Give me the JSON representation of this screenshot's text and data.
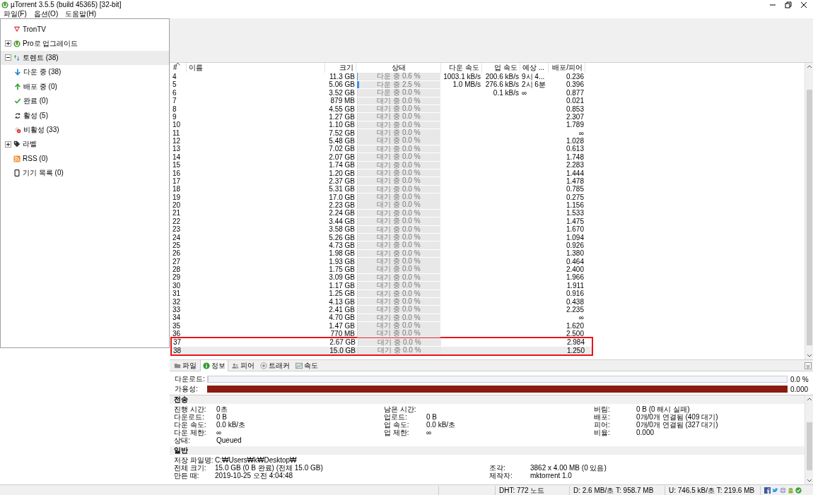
{
  "window": {
    "title": "µTorrent 3.5.5  (build 45365) [32-bit]"
  },
  "menu": [
    "파일(F)",
    "옵션(O)",
    "도움말(H)"
  ],
  "sidebar": {
    "items": [
      {
        "label": "TronTV",
        "kind": "tron",
        "selected": false
      },
      {
        "label": "Pro로 업그레이드",
        "kind": "utorrent",
        "selected": false,
        "expanded": false
      },
      {
        "label": "토렌트 (38)",
        "kind": "torrents",
        "selected": true,
        "expanded": true,
        "children": [
          {
            "label": "다운 중 (38)",
            "kind": "down",
            "selected": false
          },
          {
            "label": "배포 중 (0)",
            "kind": "up",
            "selected": false
          },
          {
            "label": "완료 (0)",
            "kind": "check",
            "selected": false
          },
          {
            "label": "활성 (5)",
            "kind": "refresh",
            "selected": false
          },
          {
            "label": "비활성 (33)",
            "kind": "inactive",
            "selected": false
          }
        ]
      },
      {
        "label": "라벨",
        "kind": "tag",
        "selected": false,
        "expanded": false
      },
      {
        "label": "RSS (0)",
        "kind": "rss",
        "selected": false
      },
      {
        "label": "기기 목록 (0)",
        "kind": "device",
        "selected": false
      }
    ]
  },
  "table": {
    "columns": [
      "#",
      "이름",
      "크기",
      "상태",
      "다운 속도",
      "업 속도",
      "예상 ...",
      "배포/피어"
    ],
    "rows": [
      {
        "num": "4",
        "size": "11.3 GB",
        "status": "다운 중 0.6 %",
        "level": 0.006,
        "down": "1003.1 kB/s",
        "up": "200.6 kB/s",
        "eta": "9시 4...",
        "ratio": "0.236",
        "selected": false,
        "outlined": false
      },
      {
        "num": "5",
        "size": "5.06 GB",
        "status": "다운 중 2.5 %",
        "level": 0.025,
        "down": "1.0 MB/s",
        "up": "276.6 kB/s",
        "eta": "2시 6분",
        "ratio": "0.396",
        "selected": false,
        "outlined": false
      },
      {
        "num": "6",
        "size": "3.52 GB",
        "status": "다운 중 0.0 %",
        "level": 0,
        "up": "0.1 kB/s",
        "eta": "∞",
        "ratio": "0.877",
        "selected": false,
        "outlined": false
      },
      {
        "num": "7",
        "size": "879 MB",
        "status": "대기 중 0.0 %",
        "level": 0,
        "ratio": "0.021",
        "selected": false,
        "outlined": false
      },
      {
        "num": "8",
        "size": "4.55 GB",
        "status": "대기 중 0.0 %",
        "level": 0,
        "ratio": "0.853",
        "selected": false,
        "outlined": false
      },
      {
        "num": "9",
        "size": "1.27 GB",
        "status": "대기 중 0.0 %",
        "level": 0,
        "ratio": "2.307",
        "selected": false,
        "outlined": false
      },
      {
        "num": "10",
        "size": "1.10 GB",
        "status": "대기 중 0.0 %",
        "level": 0,
        "ratio": "1.789",
        "selected": false,
        "outlined": false
      },
      {
        "num": "11",
        "size": "7.52 GB",
        "status": "대기 중 0.0 %",
        "level": 0,
        "ratio": "∞",
        "selected": false,
        "outlined": false
      },
      {
        "num": "12",
        "size": "5.48 GB",
        "status": "대기 중 0.0 %",
        "level": 0,
        "ratio": "1.028",
        "selected": false,
        "outlined": false
      },
      {
        "num": "13",
        "size": "7.02 GB",
        "status": "대기 중 0.0 %",
        "level": 0,
        "ratio": "0.613",
        "selected": false,
        "outlined": false
      },
      {
        "num": "14",
        "size": "2.07 GB",
        "status": "대기 중 0.0 %",
        "level": 0,
        "ratio": "1.748",
        "selected": false,
        "outlined": false
      },
      {
        "num": "15",
        "size": "1.74 GB",
        "status": "대기 중 0.0 %",
        "level": 0,
        "ratio": "2.283",
        "selected": false,
        "outlined": false
      },
      {
        "num": "16",
        "size": "1.20 GB",
        "status": "대기 중 0.0 %",
        "level": 0,
        "ratio": "1.444",
        "selected": false,
        "outlined": false
      },
      {
        "num": "17",
        "size": "2.37 GB",
        "status": "대기 중 0.0 %",
        "level": 0,
        "ratio": "1.478",
        "selected": false,
        "outlined": false
      },
      {
        "num": "18",
        "size": "5.31 GB",
        "status": "대기 중 0.0 %",
        "level": 0,
        "ratio": "0.785",
        "selected": false,
        "outlined": false
      },
      {
        "num": "19",
        "size": "17.0 GB",
        "status": "대기 중 0.0 %",
        "level": 0,
        "ratio": "0.275",
        "selected": false,
        "outlined": false
      },
      {
        "num": "20",
        "size": "2.23 GB",
        "status": "대기 중 0.0 %",
        "level": 0,
        "ratio": "1.156",
        "selected": false,
        "outlined": false
      },
      {
        "num": "21",
        "size": "2.24 GB",
        "status": "대기 중 0.0 %",
        "level": 0,
        "ratio": "1.533",
        "selected": false,
        "outlined": false
      },
      {
        "num": "22",
        "size": "3.44 GB",
        "status": "대기 중 0.0 %",
        "level": 0,
        "ratio": "1.475",
        "selected": false,
        "outlined": false
      },
      {
        "num": "23",
        "size": "3.58 GB",
        "status": "대기 중 0.0 %",
        "level": 0,
        "ratio": "1.670",
        "selected": false,
        "outlined": false
      },
      {
        "num": "24",
        "size": "5.26 GB",
        "status": "대기 중 0.0 %",
        "level": 0,
        "ratio": "1.094",
        "selected": false,
        "outlined": false
      },
      {
        "num": "25",
        "size": "4.73 GB",
        "status": "대기 중 0.0 %",
        "level": 0,
        "ratio": "0.926",
        "selected": false,
        "outlined": false
      },
      {
        "num": "26",
        "size": "1.98 GB",
        "status": "대기 중 0.0 %",
        "level": 0,
        "ratio": "1.380",
        "selected": false,
        "outlined": false
      },
      {
        "num": "27",
        "size": "1.93 GB",
        "status": "대기 중 0.0 %",
        "level": 0,
        "ratio": "0.464",
        "selected": false,
        "outlined": false
      },
      {
        "num": "28",
        "size": "1.75 GB",
        "status": "대기 중 0.0 %",
        "level": 0,
        "ratio": "2.400",
        "selected": false,
        "outlined": false
      },
      {
        "num": "29",
        "size": "3.09 GB",
        "status": "대기 중 0.0 %",
        "level": 0,
        "ratio": "1.966",
        "selected": false,
        "outlined": false
      },
      {
        "num": "30",
        "size": "1.17 GB",
        "status": "대기 중 0.0 %",
        "level": 0,
        "ratio": "1.911",
        "selected": false,
        "outlined": false
      },
      {
        "num": "31",
        "size": "1.25 GB",
        "status": "대기 중 0.0 %",
        "level": 0,
        "ratio": "0.916",
        "selected": false,
        "outlined": false
      },
      {
        "num": "32",
        "size": "4.13 GB",
        "status": "대기 중 0.0 %",
        "level": 0,
        "ratio": "0.438",
        "selected": false,
        "outlined": false
      },
      {
        "num": "33",
        "size": "2.41 GB",
        "status": "대기 중 0.0 %",
        "level": 0,
        "ratio": "2.235",
        "selected": false,
        "outlined": false
      },
      {
        "num": "34",
        "size": "4.70 GB",
        "status": "대기 중 0.0 %",
        "level": 0,
        "ratio": "∞",
        "selected": false,
        "outlined": false
      },
      {
        "num": "35",
        "size": "1.47 GB",
        "status": "대기 중 0.0 %",
        "level": 0,
        "ratio": "1.620",
        "selected": false,
        "outlined": false
      },
      {
        "num": "36",
        "size": "770 MB",
        "status": "대기 중 0.0 %",
        "level": 0,
        "ratio": "2.500",
        "selected": false,
        "outlined": false
      },
      {
        "num": "37",
        "size": "2.67 GB",
        "status": "대기 중 0.0 %",
        "level": 0,
        "ratio": "2.984",
        "selected": false,
        "outlined": true
      },
      {
        "num": "38",
        "size": "15.0 GB",
        "status": "대기 중 0.0 %",
        "level": 0,
        "ratio": "1.250",
        "selected": true,
        "outlined": true
      }
    ]
  },
  "detail_tabs": [
    {
      "label": "파일",
      "kind": "folder",
      "selected": false
    },
    {
      "label": "정보",
      "kind": "info",
      "selected": true
    },
    {
      "label": "피어",
      "kind": "peers",
      "selected": false
    },
    {
      "label": "트래커",
      "kind": "tracker",
      "selected": false
    },
    {
      "label": "속도",
      "kind": "graph",
      "selected": false
    }
  ],
  "bars": [
    {
      "label": "다운로드:",
      "level": 0,
      "reading": "0.0 %",
      "kind": "progress"
    },
    {
      "label": "가용성:",
      "level": 1,
      "reading": "0.000",
      "kind": "availability"
    }
  ],
  "sections": [
    {
      "title": "전송",
      "columns": [
        [
          {
            "label": "진행 시간:",
            "value": "0초"
          },
          {
            "label": "다운로드:",
            "value": "0 B"
          },
          {
            "label": "다운 속도:",
            "value": "0.0 kB/초"
          },
          {
            "label": "다운 제한:",
            "value": "∞"
          },
          {
            "label": "상태:",
            "value": "Queued"
          }
        ],
        [
          {
            "label": "남은 시간:"
          },
          {
            "label": "업로드:",
            "value": "0 B"
          },
          {
            "label": "업 속도:",
            "value": "0.0 kB/초"
          },
          {
            "label": "업 제한:",
            "value": "∞"
          }
        ],
        [
          {
            "label": "버림:",
            "value": "0 B (0 해시 실패)"
          },
          {
            "label": "배포:",
            "value": "0개/0개 연결됨 (409 대기)"
          },
          {
            "label": "피어:",
            "value": "0개/0개 연결됨 (327 대기)"
          },
          {
            "label": "비율:",
            "value": "0.000"
          }
        ]
      ]
    },
    {
      "title": "일반",
      "columns": [
        [
          {
            "label": "저장 파일명:",
            "value": "C:₩Users₩k₩Desktop₩"
          },
          {
            "label": "전체 크기:",
            "value": "15.0 GB (0 B 완료) (전체 15.0 GB)"
          },
          {
            "label": "만든 때:",
            "value": "2019-10-25 오전 4:04:48"
          }
        ],
        [
          {
            "label": "조각:",
            "value": "3862 x 4.00 MB (0 있음)"
          },
          {
            "label": "제작자:",
            "value": "mktorrent 1.0"
          }
        ]
      ]
    }
  ],
  "status_bar": [
    "DHT: 772 노드",
    "D: 2.6 MB/초 T: 958.7 MB",
    "U: 746.5 kB/초 T: 219.6 MB"
  ]
}
